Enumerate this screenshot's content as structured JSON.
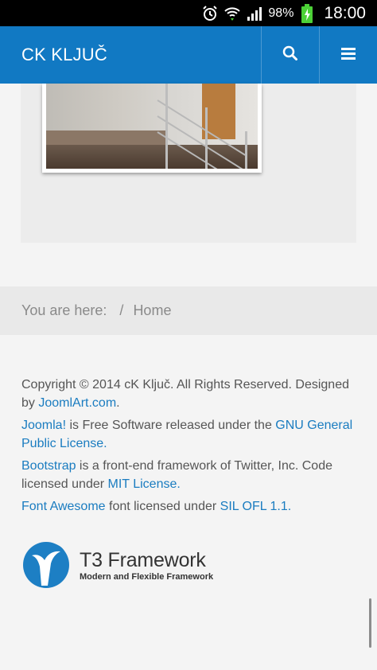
{
  "status_bar": {
    "battery_percent": "98%",
    "time": "18:00",
    "icons": [
      "alarm-icon",
      "wifi-icon",
      "signal-icon",
      "battery-charging-icon"
    ]
  },
  "header": {
    "brand": "CK KLJUČ",
    "icons": [
      "search-icon",
      "menu-icon"
    ]
  },
  "breadcrumb": {
    "label": "You are here:",
    "separator": "/",
    "home": "Home"
  },
  "footer": {
    "copyright_prefix": "Copyright © 2014 cK Ključ. All Rights Reserved. Designed by ",
    "designer_link": "JoomlArt.com",
    "copyright_suffix": ".",
    "joomla_link": "Joomla!",
    "joomla_text": " is Free Software released under the ",
    "gpl_link": "GNU General Public License.",
    "bootstrap_link": "Bootstrap",
    "bootstrap_text": " is a front-end framework of Twitter, Inc. Code licensed under ",
    "mit_link": "MIT License.",
    "fa_link": "Font Awesome",
    "fa_text": " font licensed under ",
    "sil_link": "SIL OFL 1.1."
  },
  "t3_logo": {
    "title": "T3 Framework",
    "subtitle": "Modern and Flexible Framework",
    "brand_color": "#1d7fc4"
  },
  "colors": {
    "header_bg": "#1179c3",
    "link": "#1a7cc0"
  }
}
